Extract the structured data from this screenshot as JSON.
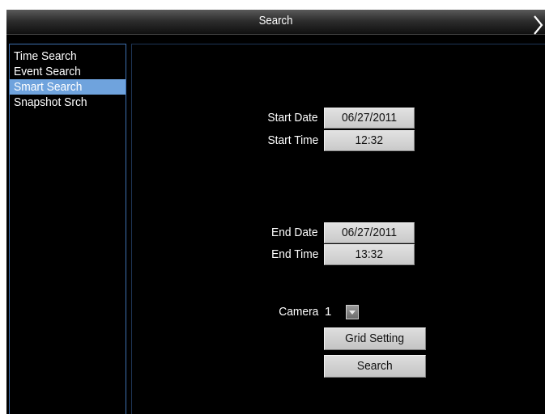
{
  "window": {
    "title": "Search",
    "close_icon": "close-chevron-icon"
  },
  "sidebar": {
    "items": [
      {
        "label": "Time Search",
        "selected": false
      },
      {
        "label": "Event Search",
        "selected": false
      },
      {
        "label": "Smart Search",
        "selected": true
      },
      {
        "label": "Snapshot Srch",
        "selected": false
      }
    ]
  },
  "form": {
    "start_date_label": "Start Date",
    "start_date_value": "06/27/2011",
    "start_time_label": "Start Time",
    "start_time_value": "12:32",
    "end_date_label": "End Date",
    "end_date_value": "06/27/2011",
    "end_time_label": "End Time",
    "end_time_value": "13:32",
    "camera_label": "Camera",
    "camera_value": "1",
    "camera_dropdown_icon": "chevron-down-icon"
  },
  "buttons": {
    "grid_setting_label": "Grid Setting",
    "search_label": "Search"
  },
  "colors": {
    "background": "#000000",
    "selected_item": "#6fa3dd",
    "sidebar_border": "#3e6fae",
    "button_face": "#d0d0d0"
  }
}
